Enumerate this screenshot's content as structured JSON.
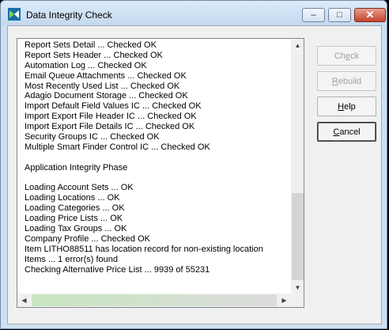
{
  "window": {
    "title": "Data Integrity Check"
  },
  "titlebar_buttons": {
    "minimize": "–",
    "maximize": "□",
    "close": "✕"
  },
  "log": {
    "lines": [
      "Report Sets Detail ... Checked OK",
      "Report Sets Header ... Checked OK",
      "Automation Log ... Checked OK",
      "Email Queue Attachments ... Checked OK",
      "Most Recently Used List ... Checked OK",
      "Adagio Document Storage ... Checked OK",
      "Import Default Field Values IC ... Checked OK",
      "Import Export File Header IC ... Checked OK",
      "Import Export File Details IC ... Checked OK",
      "Security Groups IC ... Checked OK",
      "Multiple Smart Finder Control IC ... Checked OK",
      "",
      "Application Integrity Phase",
      "",
      "Loading Account Sets ... OK",
      "Loading Locations ... OK",
      "Loading Categories ... OK",
      "Loading Price Lists ... OK",
      "Loading Tax Groups ... OK",
      "Company Profile ... Checked OK",
      "Item LITHO88511 has location record for non-existing location",
      "Items ... 1 error(s) found",
      "Checking Alternative Price List ... 9939 of 55231"
    ]
  },
  "buttons": {
    "check": {
      "prefix": "Ch",
      "mnemonic": "e",
      "suffix": "ck",
      "enabled": false
    },
    "rebuild": {
      "prefix": "",
      "mnemonic": "R",
      "suffix": "ebuild",
      "enabled": false
    },
    "help": {
      "prefix": "",
      "mnemonic": "H",
      "suffix": "elp",
      "enabled": true
    },
    "cancel": {
      "prefix": "",
      "mnemonic": "C",
      "suffix": "ancel",
      "enabled": true
    }
  },
  "colors": {
    "titlebar": "#cfe0f1",
    "close_button": "#c4422c",
    "disabled_text": "#a0a0a0"
  }
}
